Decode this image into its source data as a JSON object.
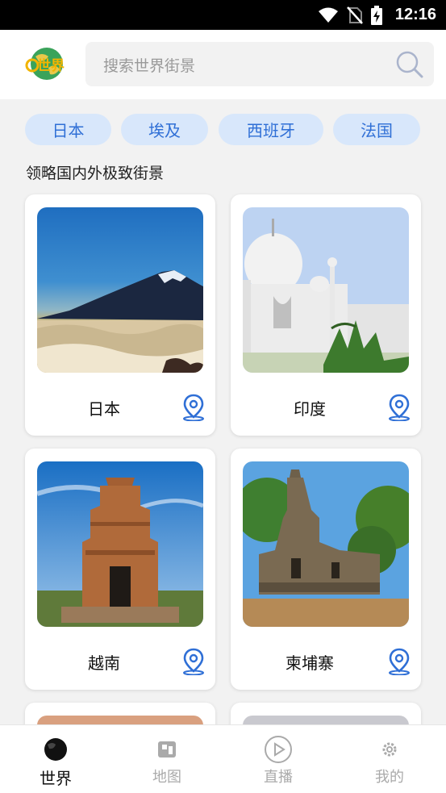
{
  "status_bar": {
    "time": "12:16",
    "icons": [
      "wifi-icon",
      "no-sim-icon",
      "battery-charging-icon"
    ]
  },
  "header": {
    "logo_text": "世界",
    "search": {
      "placeholder": "搜索世界街景",
      "icon": "search-icon"
    }
  },
  "chips": [
    {
      "label": "日本"
    },
    {
      "label": "埃及"
    },
    {
      "label": "西班牙"
    },
    {
      "label": "法国"
    }
  ],
  "section_title": "领略国内外极致街景",
  "cards": [
    {
      "name": "日本",
      "image": "mount-fuji-photo",
      "icon": "location-pin-icon"
    },
    {
      "name": "印度",
      "image": "taj-mahal-photo",
      "icon": "location-pin-icon"
    },
    {
      "name": "越南",
      "image": "cham-tower-photo",
      "icon": "location-pin-icon"
    },
    {
      "name": "柬埔寨",
      "image": "angkor-temple-photo",
      "icon": "location-pin-icon"
    }
  ],
  "tabbar": [
    {
      "label": "世界",
      "icon": "globe-icon",
      "active": true
    },
    {
      "label": "地图",
      "icon": "map-icon",
      "active": false
    },
    {
      "label": "直播",
      "icon": "play-icon",
      "active": false
    },
    {
      "label": "我的",
      "icon": "settings-icon",
      "active": false
    }
  ],
  "colors": {
    "accent": "#2f6fd6",
    "chip_bg": "#d8e7fb",
    "page_bg": "#f2f2f2"
  }
}
